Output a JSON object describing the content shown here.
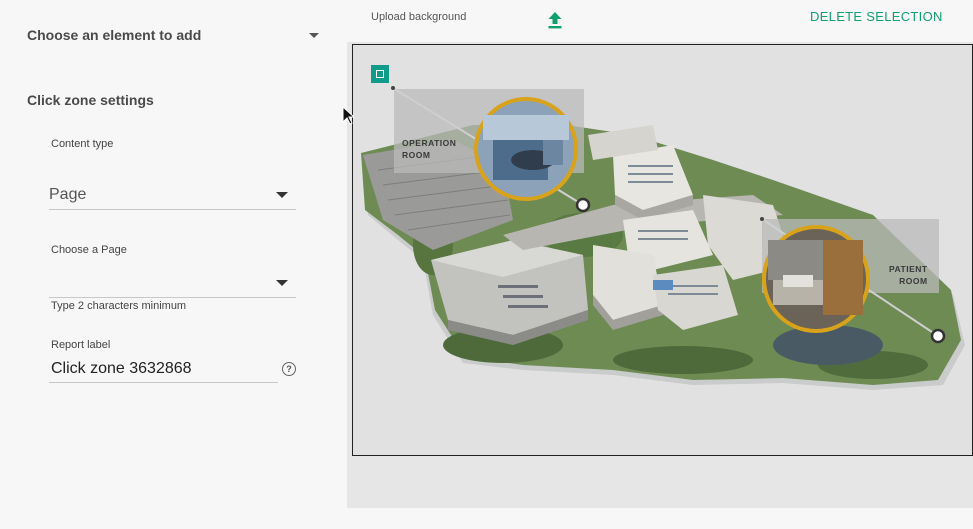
{
  "sidebar": {
    "element_select": "Choose an element to add",
    "section_title": "Click zone settings",
    "content_type": {
      "label": "Content type",
      "value": "Page"
    },
    "page_select": {
      "label": "Choose a Page",
      "value": "",
      "hint": "Type 2 characters minimum"
    },
    "report_label": {
      "label": "Report label",
      "value": "Click zone 3632868"
    },
    "help_glyph": "?"
  },
  "toolbar": {
    "upload_label": "Upload background",
    "upload_icon": "upload-icon",
    "delete_label": "DELETE SELECTION",
    "accent": "#11a06f"
  },
  "canvas": {
    "hotspots": [
      {
        "line1": "OPERATION",
        "line2": "ROOM"
      },
      {
        "line1": "PATIENT",
        "line2": "ROOM"
      }
    ],
    "zone_color": "#119b8a",
    "ring_color": "#d9a21b"
  }
}
